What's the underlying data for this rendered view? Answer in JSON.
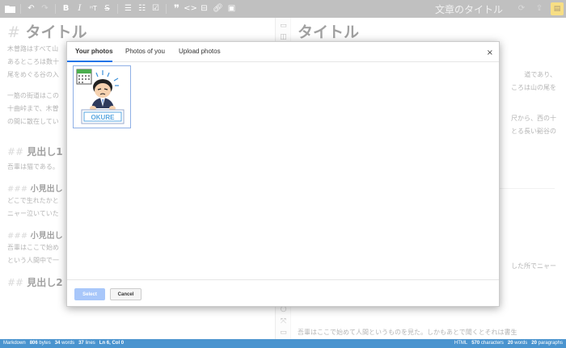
{
  "toolbar": {
    "icons": [
      "folder-icon",
      "undo-icon",
      "redo-icon",
      "bold-icon",
      "italic-icon",
      "heading-icon",
      "strikethrough-icon",
      "bulleted-list-icon",
      "numbered-list-icon",
      "checklist-icon",
      "quote-icon",
      "code-icon",
      "horizontal-rule-icon",
      "link-icon",
      "image-icon"
    ],
    "document_title": "文章のタイトル"
  },
  "editor": {
    "h1_marker": "#",
    "h1_text": "タイトル",
    "p1": [
      "木曽路はすべて山",
      "あるところは数十",
      "尾をめぐる谷の入"
    ],
    "p2": [
      "一筋の街道はこの",
      "十曲峠まで、木曽",
      "の間に散在してい"
    ],
    "h2a_marker": "##",
    "h2a_text": "見出し1",
    "p3": "吾輩は猫である。",
    "h3a_marker": "###",
    "h3a_text": "小見出し",
    "p4": [
      "どこで生れたかと",
      "ニャー泣いていた"
    ],
    "h3b_marker": "###",
    "h3b_text": "小見出し",
    "p5": [
      "吾輩はここで始め",
      "という人間中で一"
    ],
    "h2b_marker": "##",
    "h2b_text": "見出し2"
  },
  "preview": {
    "h1_text": "タイトル",
    "line1": "道であり、",
    "line2": "ころは山の尾を",
    "line3": "尺から、西の十",
    "line4": "とる長い谿谷の",
    "line5": "した所でニャー",
    "line6": "吾輩はここで始めて人間というものを見た。しかもあとで聞くとそれは書生"
  },
  "modal": {
    "tabs": [
      "Your photos",
      "Photos of you",
      "Upload photos"
    ],
    "active_tab": "Your photos",
    "close_label": "×",
    "photo_badge": "OKURE"
  },
  "footer": {
    "select_label": "Select",
    "cancel_label": "Cancel"
  },
  "status": {
    "mode": "Markdown",
    "bytes_value": "806",
    "bytes_unit": "bytes",
    "words_value": "34",
    "words_unit": "words",
    "lines_value": "37",
    "lines_unit": "lines",
    "cursor": "Ln 6, Col 0",
    "preview_mode": "HTML",
    "chars_value": "570",
    "chars_unit": "characters",
    "pwords_value": "20",
    "pwords_unit": "words",
    "para_value": "20",
    "para_unit": "paragraphs"
  },
  "colors": {
    "toolbar_bg": "#8c8c8c",
    "status_bg": "#4a94cf",
    "accent": "#1a73e8",
    "select_btn": "#a8c7fa",
    "active_tool": "#f0c420"
  }
}
